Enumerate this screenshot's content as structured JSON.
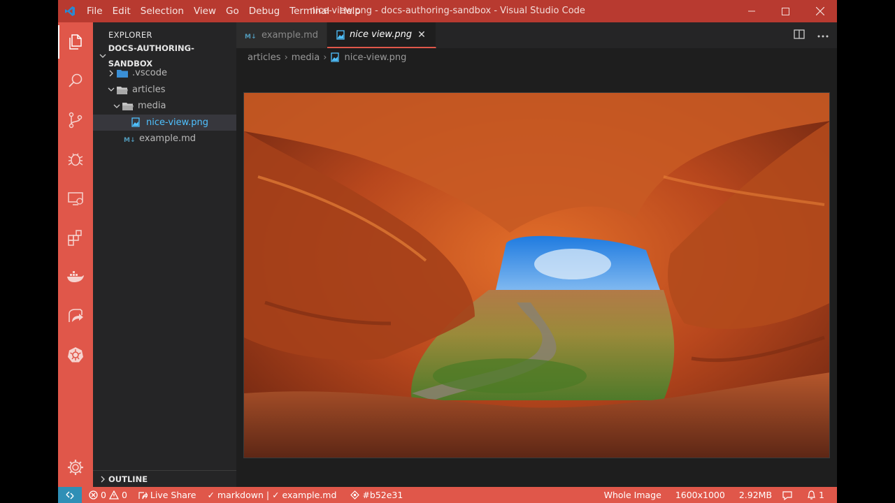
{
  "window": {
    "title": "nice-view.png - docs-authoring-sandbox - Visual Studio Code"
  },
  "menu": [
    "File",
    "Edit",
    "Selection",
    "View",
    "Go",
    "Debug",
    "Terminal",
    "Help"
  ],
  "colors": {
    "titlebar": "#b83a30",
    "activitybar": "#e0574a",
    "statusbar": "#e0574a",
    "remote": "#2f8fb6",
    "selected_file": "#4fc1ff"
  },
  "activity_icons": [
    "explorer-icon",
    "search-icon",
    "source-control-icon",
    "debug-icon",
    "remote-explorer-icon",
    "extensions-icon",
    "docker-icon",
    "live-share-icon",
    "kubernetes-icon",
    "gear-icon"
  ],
  "sidebar": {
    "title": "EXPLORER",
    "workspace": "DOCS-AUTHORING-SANDBOX",
    "tree": [
      {
        "label": ".vscode",
        "type": "folder",
        "expanded": false
      },
      {
        "label": "articles",
        "type": "folder",
        "expanded": true
      },
      {
        "label": "media",
        "type": "folder",
        "expanded": true
      },
      {
        "label": "nice-view.png",
        "type": "image",
        "selected": true
      },
      {
        "label": "example.md",
        "type": "markdown"
      }
    ],
    "outline": "OUTLINE"
  },
  "editor": {
    "tabs": [
      {
        "label": "example.md",
        "icon": "markdown-icon",
        "active": false
      },
      {
        "label": "nice view.png",
        "icon": "image-file-icon",
        "active": true,
        "close": "✕"
      }
    ],
    "breadcrumb": [
      "articles",
      "media",
      "nice-view.png"
    ],
    "image_description_alt": "nice-view.png"
  },
  "statusbar": {
    "errors": "0",
    "warnings": "0",
    "live_share": "Live Share",
    "language": "markdown | ✓ example.md",
    "commit": "#b52e31",
    "zoom": "Whole Image",
    "dimensions": "1600x1000",
    "size": "2.92MB",
    "notifications": "1"
  }
}
